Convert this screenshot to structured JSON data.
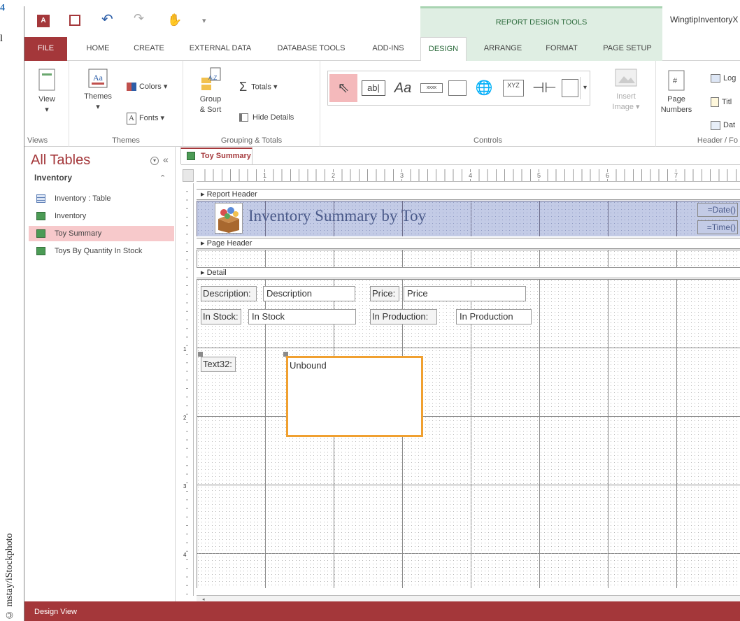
{
  "credit": "© mstay/iStockphoto",
  "edge_marks": [
    "4",
    "l"
  ],
  "colors": {
    "accent": "#a4373a",
    "tool_tab_bg": "#dfeee3",
    "tool_tab_text": "#2b6a3b",
    "header_band": "#c3cbe6"
  },
  "window": {
    "tool_context": "REPORT DESIGN TOOLS",
    "title": "WingtipInventoryX"
  },
  "quick_access": [
    "app-icon",
    "save-icon",
    "undo-icon",
    "redo-icon",
    "touch-mode-icon",
    "customize-icon"
  ],
  "tabs": [
    "FILE",
    "HOME",
    "CREATE",
    "EXTERNAL DATA",
    "DATABASE TOOLS",
    "ADD-INS",
    "DESIGN",
    "ARRANGE",
    "FORMAT",
    "PAGE SETUP"
  ],
  "ribbon": {
    "views": {
      "group": "Views",
      "view": "View"
    },
    "themes": {
      "group": "Themes",
      "themes": "Themes",
      "colors": "Colors",
      "fonts": "Fonts"
    },
    "grouping": {
      "group": "Grouping & Totals",
      "group_sort_1": "Group",
      "group_sort_2": "& Sort",
      "totals": "Totals",
      "hide_details": "Hide Details",
      "sort_glyph": "A↓Z"
    },
    "controls": {
      "group": "Controls",
      "textbox": "ab|",
      "label": "Aa",
      "button": "xxxx",
      "chart": "XYZ",
      "insert_image_1": "Insert",
      "insert_image_2": "Image"
    },
    "header_footer": {
      "group": "Header / Fo",
      "page_numbers_1": "Page",
      "page_numbers_2": "Numbers",
      "page_glyph": "#",
      "logo": "Log",
      "title": "Titl",
      "date": "Dat"
    }
  },
  "nav": {
    "title": "All Tables",
    "section": "Inventory",
    "items": [
      {
        "label": "Inventory : Table",
        "icon": "table-icon"
      },
      {
        "label": "Inventory",
        "icon": "report-icon"
      },
      {
        "label": "Toy Summary",
        "icon": "report-icon",
        "selected": true
      },
      {
        "label": "Toys By Quantity In Stock",
        "icon": "report-icon"
      }
    ]
  },
  "document_tab": "Toy Summary",
  "ruler_numbers": [
    "1",
    "2",
    "3",
    "4",
    "5",
    "6",
    "7"
  ],
  "vruler_numbers": [
    "1",
    "2",
    "3",
    "4"
  ],
  "report": {
    "sections": {
      "report_header": "Report Header",
      "page_header": "Page Header",
      "detail": "Detail"
    },
    "title": "Inventory Summary by Toy",
    "date_field": "=Date()",
    "time_field": "=Time()",
    "detail": {
      "desc_label": "Description:",
      "desc_field": "Description",
      "price_label": "Price:",
      "price_field": "Price",
      "instock_label": "In Stock:",
      "instock_field": "In Stock",
      "inprod_label": "In Production:",
      "inprod_field": "In Production",
      "text_label": "Text32:",
      "unbound": "Unbound"
    }
  },
  "status": "Design View"
}
